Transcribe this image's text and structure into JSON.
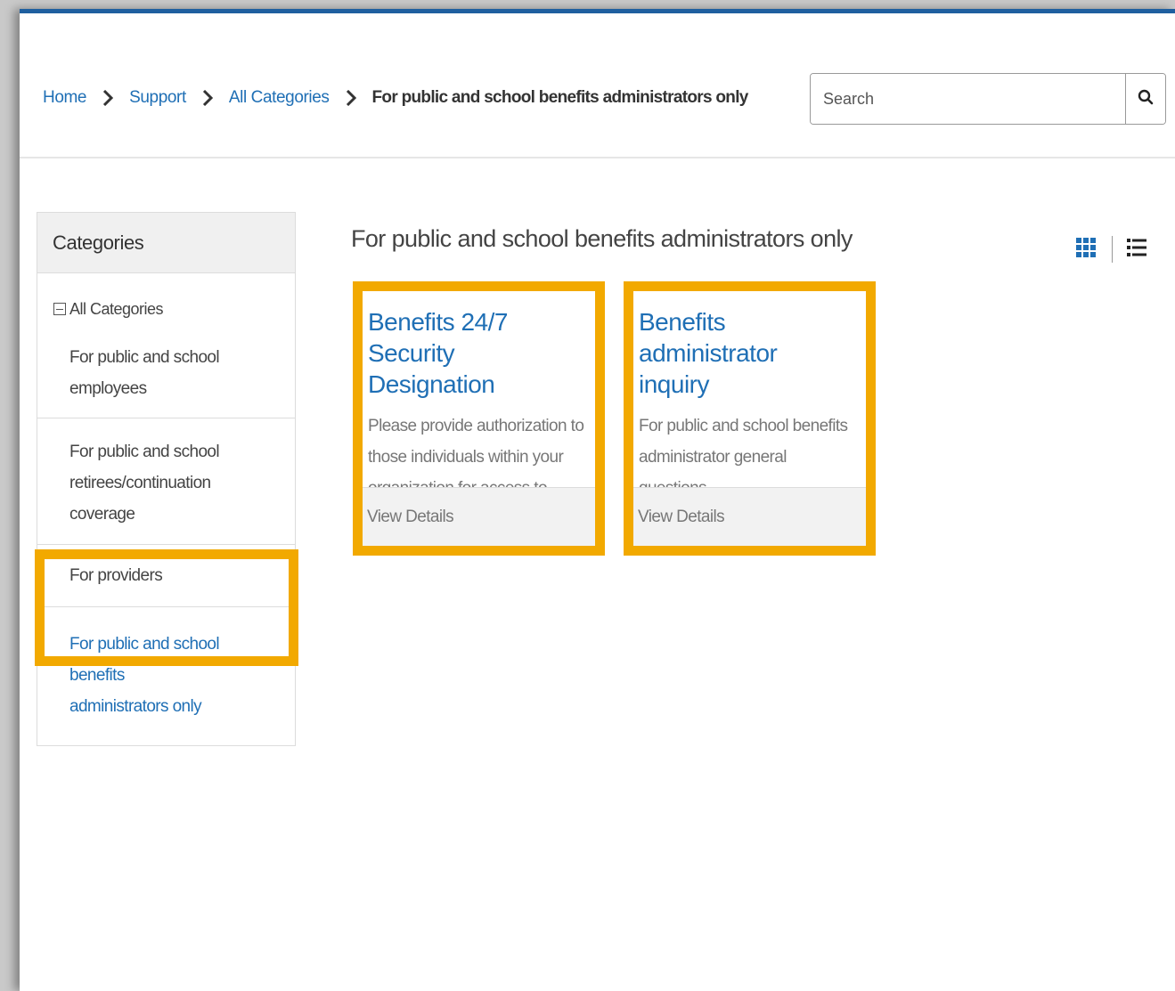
{
  "breadcrumb": {
    "items": [
      "Home",
      "Support",
      "All Categories"
    ],
    "current": "For public and school benefits administrators only"
  },
  "search": {
    "placeholder": "Search"
  },
  "sidebar": {
    "heading": "Categories",
    "all_label": "All Categories",
    "items": [
      {
        "label": "For public and school employees"
      },
      {
        "label_lines": [
          "For public and school",
          "retirees/continuation coverage"
        ]
      },
      {
        "label": "For providers"
      },
      {
        "label_lines": [
          "For public and school benefits",
          "administrators only"
        ],
        "active": true
      }
    ]
  },
  "main": {
    "title": "For public and school benefits administrators only",
    "cards": [
      {
        "title_lines": [
          "Benefits 24/7 Security",
          "Designation"
        ],
        "desc_lines": [
          "Please provide authorization to",
          "those individuals within your",
          "organization for access to Benefits"
        ],
        "footer": "View Details"
      },
      {
        "title_lines": [
          "Benefits administrator",
          "inquiry"
        ],
        "desc_lines": [
          "For public and school benefits",
          "administrator general questions."
        ],
        "footer": "View Details"
      }
    ]
  },
  "icons": {
    "breadcrumb_separator": "chevron-right-icon",
    "search": "search-icon",
    "grid_view": "grid-view-icon",
    "list_view": "list-view-icon",
    "collapse": "collapse-icon"
  },
  "colors": {
    "link": "#1f6fb5",
    "highlight": "#f2a900",
    "top_bar": "#1f5f9f"
  }
}
